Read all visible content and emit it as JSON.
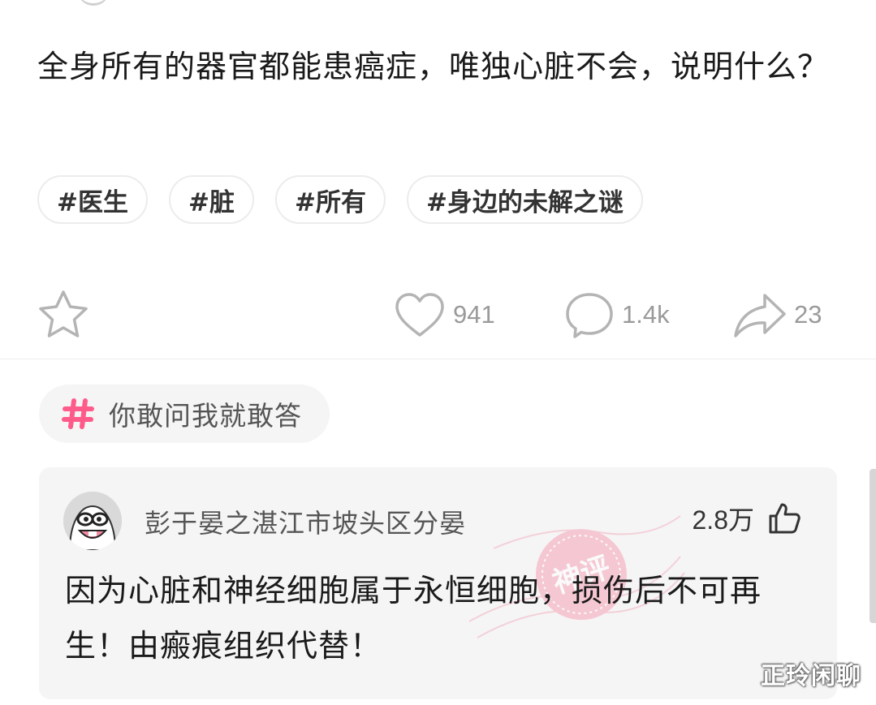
{
  "post": {
    "title": "全身所有的器官都能患癌症，唯独心脏不会，说明什么？",
    "tags": [
      "#医生",
      "#脏",
      "#所有",
      "#身边的未解之谜"
    ],
    "actions": {
      "star_icon": "star-outline",
      "likes": "941",
      "comments": "1.4k",
      "shares": "23"
    }
  },
  "topic": {
    "icon": "hash-icon",
    "label": "你敢问我就敢答",
    "accent_color": "#ff5b8a"
  },
  "comment": {
    "username": "彭于晏之湛江市坡头区分晏",
    "likes": "2.8万",
    "text": "因为心脏和神经细胞属于永恒细胞，损伤后不可再生！由瘢痕组织代替！",
    "stamp_label": "神评"
  },
  "watermark": "正玲闲聊",
  "colors": {
    "background": "#ffffff",
    "card_bg": "#f5f5f5",
    "icon_gray": "#b4b4b4",
    "stamp_pink": "#f08aa0"
  }
}
